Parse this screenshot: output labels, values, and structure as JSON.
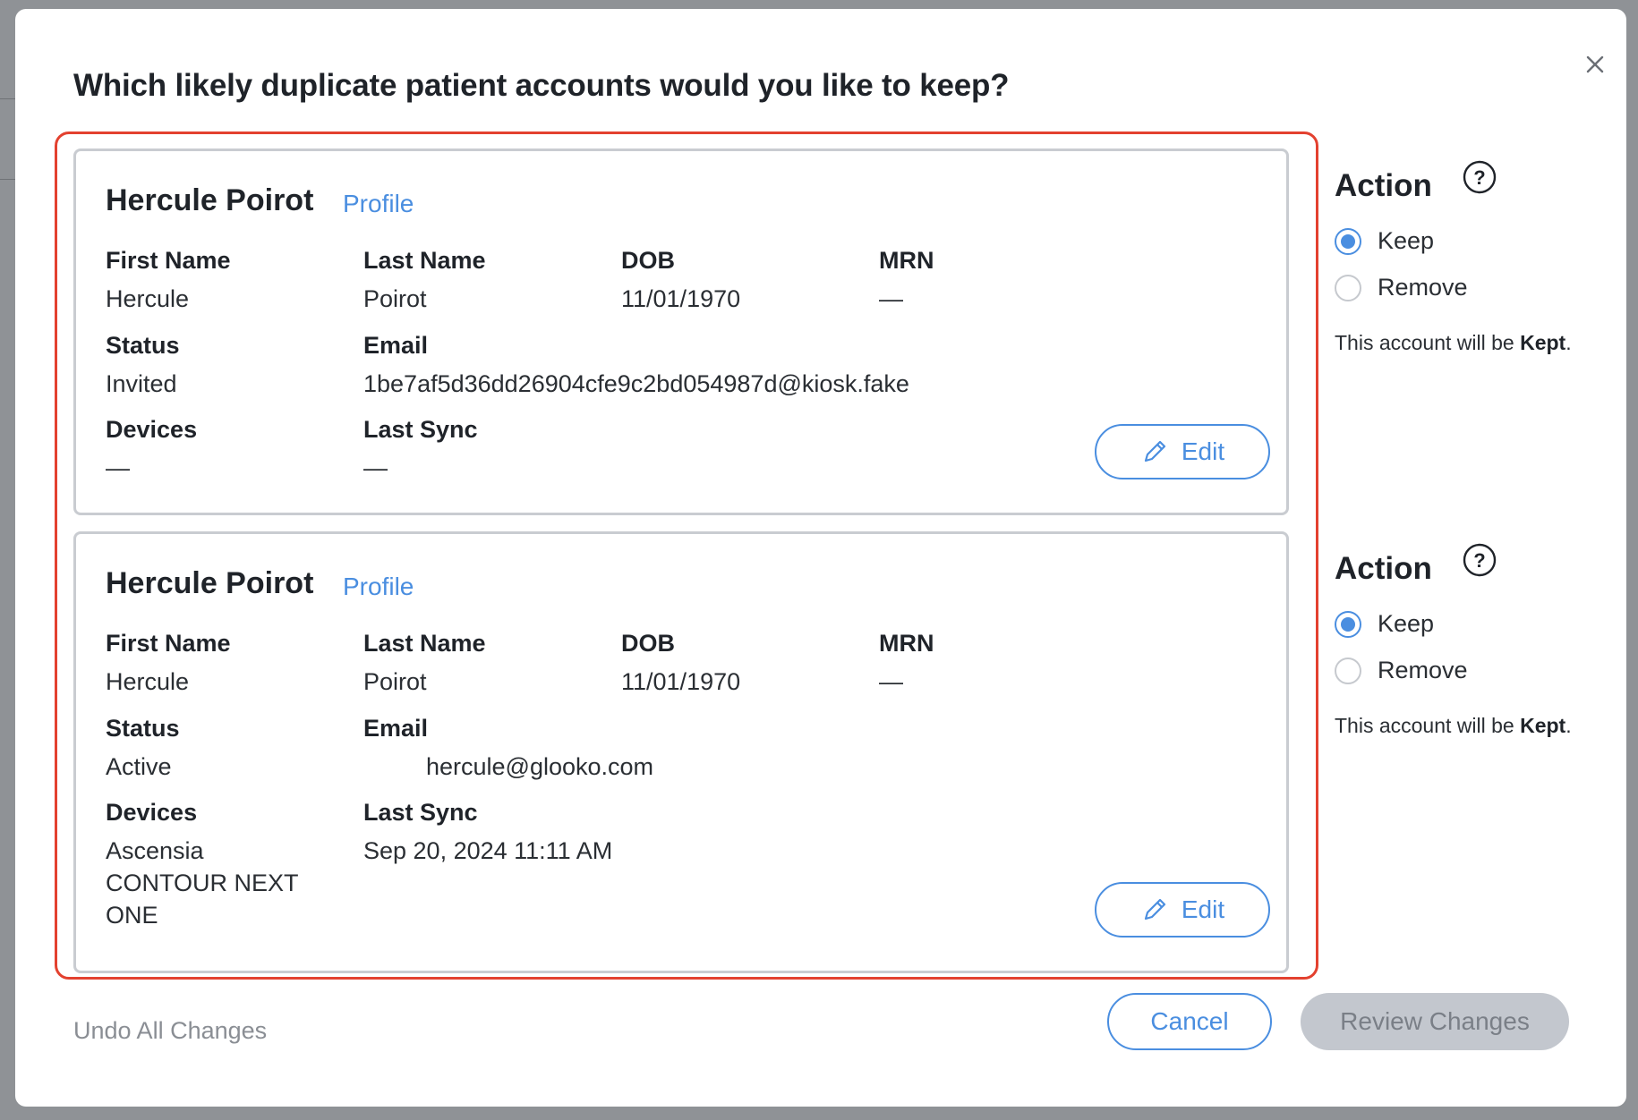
{
  "dialog": {
    "title": "Which likely duplicate patient accounts would you like to keep?"
  },
  "labels": {
    "first_name": "First Name",
    "last_name": "Last Name",
    "dob": "DOB",
    "mrn": "MRN",
    "status": "Status",
    "email": "Email",
    "devices": "Devices",
    "last_sync": "Last Sync",
    "profile": "Profile",
    "edit": "Edit"
  },
  "accounts": [
    {
      "name": "Hercule Poirot",
      "first_name": "Hercule",
      "last_name": "Poirot",
      "dob": "11/01/1970",
      "mrn": "—",
      "status": "Invited",
      "email": "1be7af5d36dd26904cfe9c2bd054987d@kiosk.fake",
      "devices": "—",
      "last_sync": "—",
      "action": {
        "title": "Action",
        "keep_label": "Keep",
        "remove_label": "Remove",
        "selected": "Keep",
        "note_prefix": "This account will be ",
        "note_value": "Kept",
        "note_suffix": "."
      }
    },
    {
      "name": "Hercule Poirot",
      "first_name": "Hercule",
      "last_name": "Poirot",
      "dob": "11/01/1970",
      "mrn": "—",
      "status": "Active",
      "email": "hercule@glooko.com",
      "devices": "Ascensia CONTOUR NEXT ONE",
      "last_sync": "Sep 20, 2024 11:11 AM",
      "action": {
        "title": "Action",
        "keep_label": "Keep",
        "remove_label": "Remove",
        "selected": "Keep",
        "note_prefix": "This account will be ",
        "note_value": "Kept",
        "note_suffix": "."
      }
    }
  ],
  "footer": {
    "undo_label": "Undo All Changes",
    "cancel_label": "Cancel",
    "review_label": "Review Changes"
  },
  "colors": {
    "accent": "#4a8ee0",
    "highlight_border": "#e3412f",
    "disabled_button": "#c3c7ce"
  }
}
